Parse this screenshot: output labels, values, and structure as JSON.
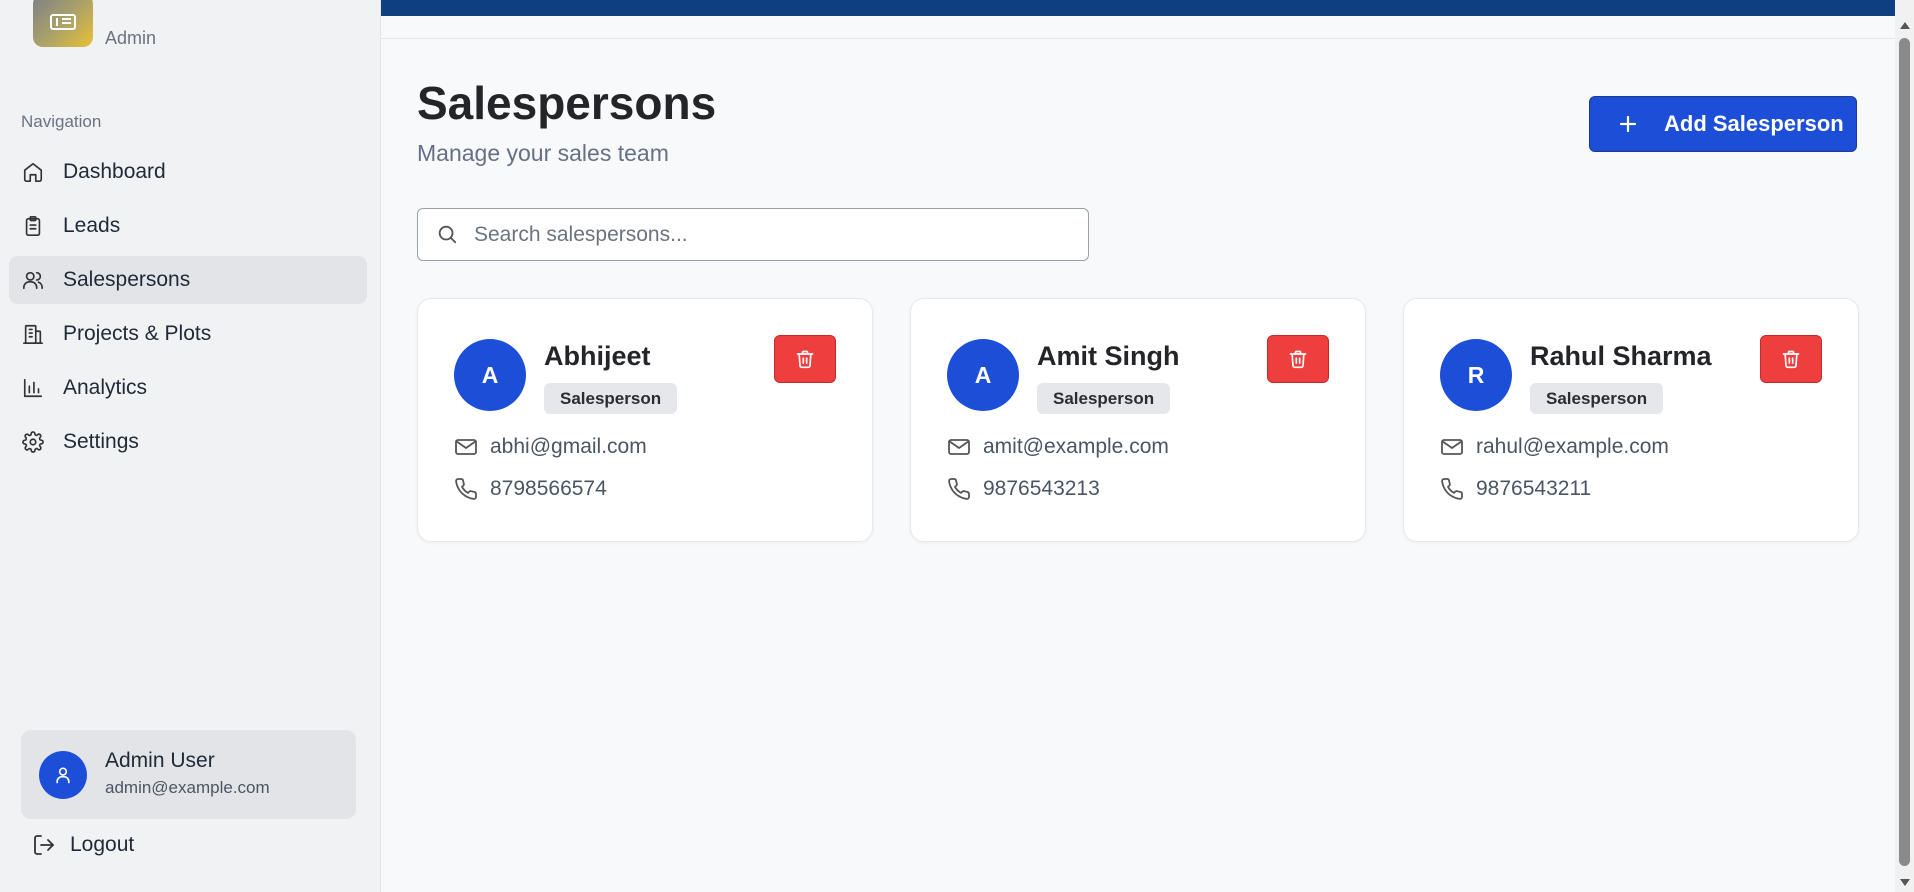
{
  "brand": {
    "subtitle": "Admin"
  },
  "nav": {
    "heading": "Navigation",
    "items": [
      {
        "label": "Dashboard",
        "icon": "home-icon"
      },
      {
        "label": "Leads",
        "icon": "clipboard-icon"
      },
      {
        "label": "Salespersons",
        "icon": "users-icon",
        "active": true
      },
      {
        "label": "Projects & Plots",
        "icon": "building-icon"
      },
      {
        "label": "Analytics",
        "icon": "bar-chart-icon"
      },
      {
        "label": "Settings",
        "icon": "gear-icon"
      }
    ]
  },
  "user": {
    "name": "Admin User",
    "email": "admin@example.com"
  },
  "logout": {
    "label": "Logout"
  },
  "page": {
    "title": "Salespersons",
    "subtitle": "Manage your sales team",
    "add_label": "Add Salesperson"
  },
  "search": {
    "placeholder": "Search salespersons...",
    "value": ""
  },
  "salespersons": [
    {
      "initial": "A",
      "name": "Abhijeet",
      "role": "Salesperson",
      "email": "abhi@gmail.com",
      "phone": "8798566574"
    },
    {
      "initial": "A",
      "name": "Amit Singh",
      "role": "Salesperson",
      "email": "amit@example.com",
      "phone": "9876543213"
    },
    {
      "initial": "R",
      "name": "Rahul Sharma",
      "role": "Salesperson",
      "email": "rahul@example.com",
      "phone": "9876543211"
    }
  ],
  "colors": {
    "primary": "#1d4ed8",
    "danger": "#ef3e3e",
    "topbar": "#0e3f80"
  }
}
